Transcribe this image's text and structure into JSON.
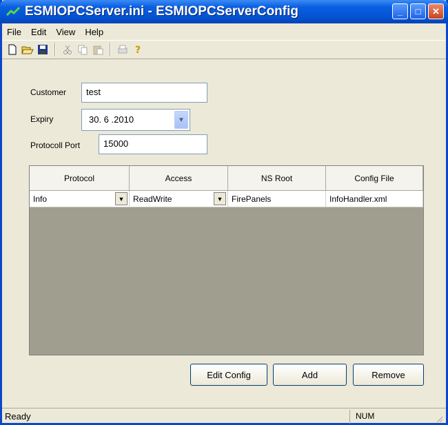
{
  "window": {
    "title": "ESMIOPCServer.ini - ESMIOPCServerConfig",
    "minimize": "_",
    "maximize": "□",
    "close": "✕"
  },
  "menu": [
    "File",
    "Edit",
    "View",
    "Help"
  ],
  "toolbar_icons": [
    "new-icon",
    "open-icon",
    "save-icon",
    "cut-icon",
    "copy-icon",
    "paste-icon",
    "print-icon",
    "help-icon"
  ],
  "form": {
    "customer_label": "Customer",
    "customer_value": "test",
    "expiry_label": "Expiry",
    "expiry_value": "30. 6 .2010",
    "port_label": "Protocoll Port",
    "port_value": "15000"
  },
  "grid": {
    "columns": [
      "Protocol",
      "Access",
      "NS Root",
      "Config File"
    ],
    "rows": [
      [
        "Info",
        "ReadWrite",
        "FirePanels",
        "InfoHandler.xml"
      ]
    ]
  },
  "buttons": {
    "edit_config": "Edit Config",
    "add": "Add",
    "remove": "Remove"
  },
  "status": {
    "text": "Ready",
    "num": "NUM"
  },
  "colors": {
    "titlebar": "#0454d4",
    "window_bg": "#ece9d8",
    "grid_bg": "#a09e8f"
  }
}
